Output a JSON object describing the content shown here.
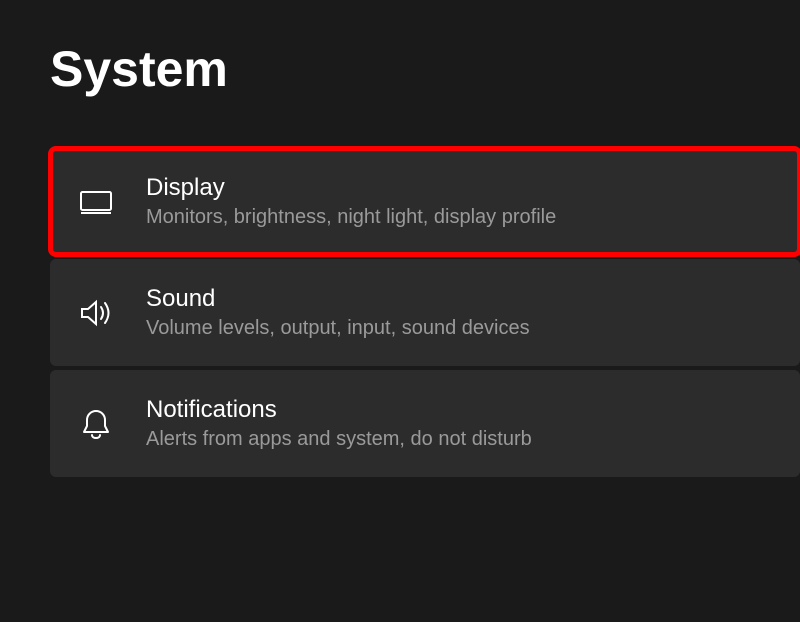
{
  "header": {
    "title": "System"
  },
  "items": [
    {
      "title": "Display",
      "subtitle": "Monitors, brightness, night light, display profile",
      "highlighted": true
    },
    {
      "title": "Sound",
      "subtitle": "Volume levels, output, input, sound devices",
      "highlighted": false
    },
    {
      "title": "Notifications",
      "subtitle": "Alerts from apps and system, do not disturb",
      "highlighted": false
    }
  ]
}
